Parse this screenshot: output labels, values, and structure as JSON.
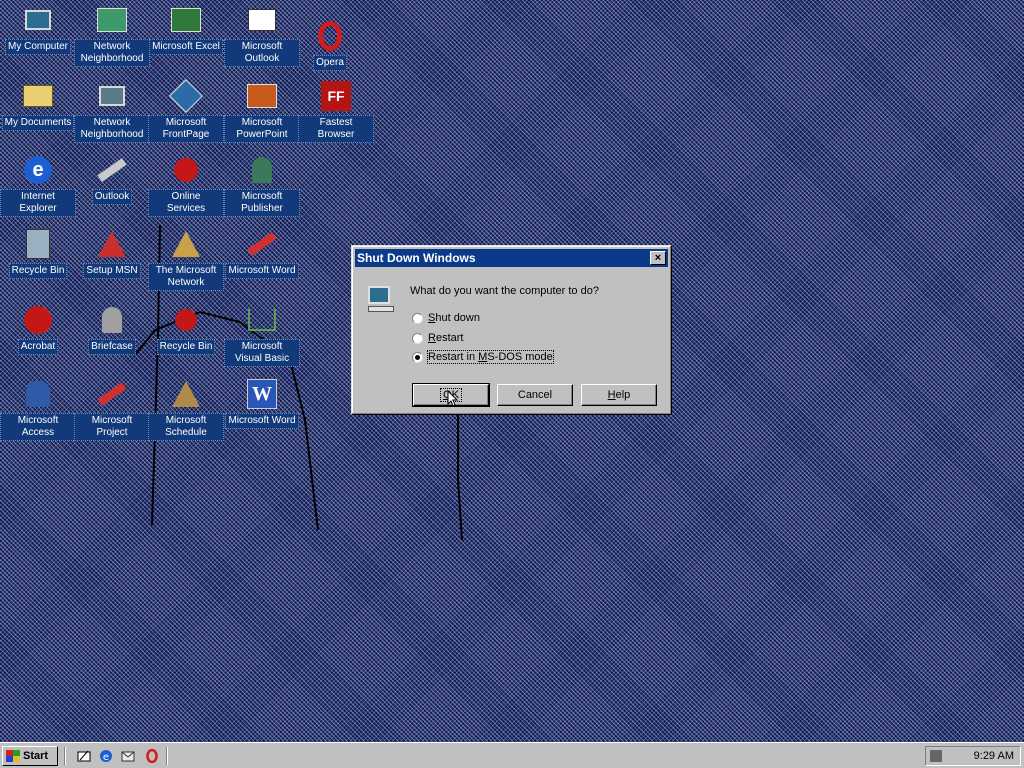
{
  "desktop": {
    "icons": [
      {
        "label": "My Computer",
        "icon": "computer-icon"
      },
      {
        "label": "Network Neighborhood",
        "icon": "network-icon"
      },
      {
        "label": "Microsoft Excel",
        "icon": "excel-icon"
      },
      {
        "label": "Microsoft Outlook",
        "icon": "outlook-icon"
      },
      {
        "label": "Opera",
        "icon": "opera-icon"
      },
      {
        "label": "My Documents",
        "icon": "folder-icon"
      },
      {
        "label": "Network Neighborhood",
        "icon": "network-icon"
      },
      {
        "label": "Microsoft FrontPage",
        "icon": "frontpage-icon"
      },
      {
        "label": "Microsoft PowerPoint",
        "icon": "powerpoint-icon"
      },
      {
        "label": "Fastest Browser",
        "icon": "ff-icon"
      },
      {
        "label": "Internet Explorer",
        "icon": "ie-icon"
      },
      {
        "label": "Outlook",
        "icon": "pencil-icon"
      },
      {
        "label": "Online Services",
        "icon": "online-icon"
      },
      {
        "label": "Microsoft Publisher",
        "icon": "publisher-icon"
      },
      {
        "label": "Recycle Bin",
        "icon": "recycle-icon"
      },
      {
        "label": "Setup MSN",
        "icon": "setup-icon"
      },
      {
        "label": "The Microsoft Network",
        "icon": "msn-icon"
      },
      {
        "label": "Microsoft Word",
        "icon": "word-icon"
      },
      {
        "label": "Acrobat",
        "icon": "acrobat-icon"
      },
      {
        "label": "Briefcase",
        "icon": "briefcase-icon"
      },
      {
        "label": "Recycle Bin",
        "icon": "recycle-icon"
      },
      {
        "label": "Microsoft Visual Basic",
        "icon": "cart-icon"
      },
      {
        "label": "Microsoft Access",
        "icon": "access-icon"
      },
      {
        "label": "Microsoft Project",
        "icon": "project-icon"
      },
      {
        "label": "Microsoft Schedule",
        "icon": "schedule-icon"
      },
      {
        "label": "Microsoft Word",
        "icon": "word-icon"
      }
    ]
  },
  "dialog": {
    "title": "Shut Down Windows",
    "close_glyph": "×",
    "question": "What do you want the computer to do?",
    "options": [
      {
        "mnemonic": "S",
        "rest": "hut down",
        "selected": false
      },
      {
        "mnemonic": "R",
        "rest": "estart",
        "selected": false
      },
      {
        "mnemonic": "",
        "rest": "Restart in MS-DOS mode",
        "mnemonic_inline": "M",
        "selected": true
      }
    ],
    "option3_pre": "Restart in ",
    "option3_mn": "M",
    "option3_post": "S-DOS mode",
    "ok_pre": "",
    "ok_mn": "O",
    "ok_post": "K",
    "cancel_label": "Cancel",
    "help_mn": "H",
    "help_post": "elp"
  },
  "taskbar": {
    "start_label": "Start",
    "clock": "9:29 AM",
    "quicklaunch": [
      "desktop-icon",
      "ie-icon",
      "outlook-icon",
      "opera-icon"
    ]
  }
}
